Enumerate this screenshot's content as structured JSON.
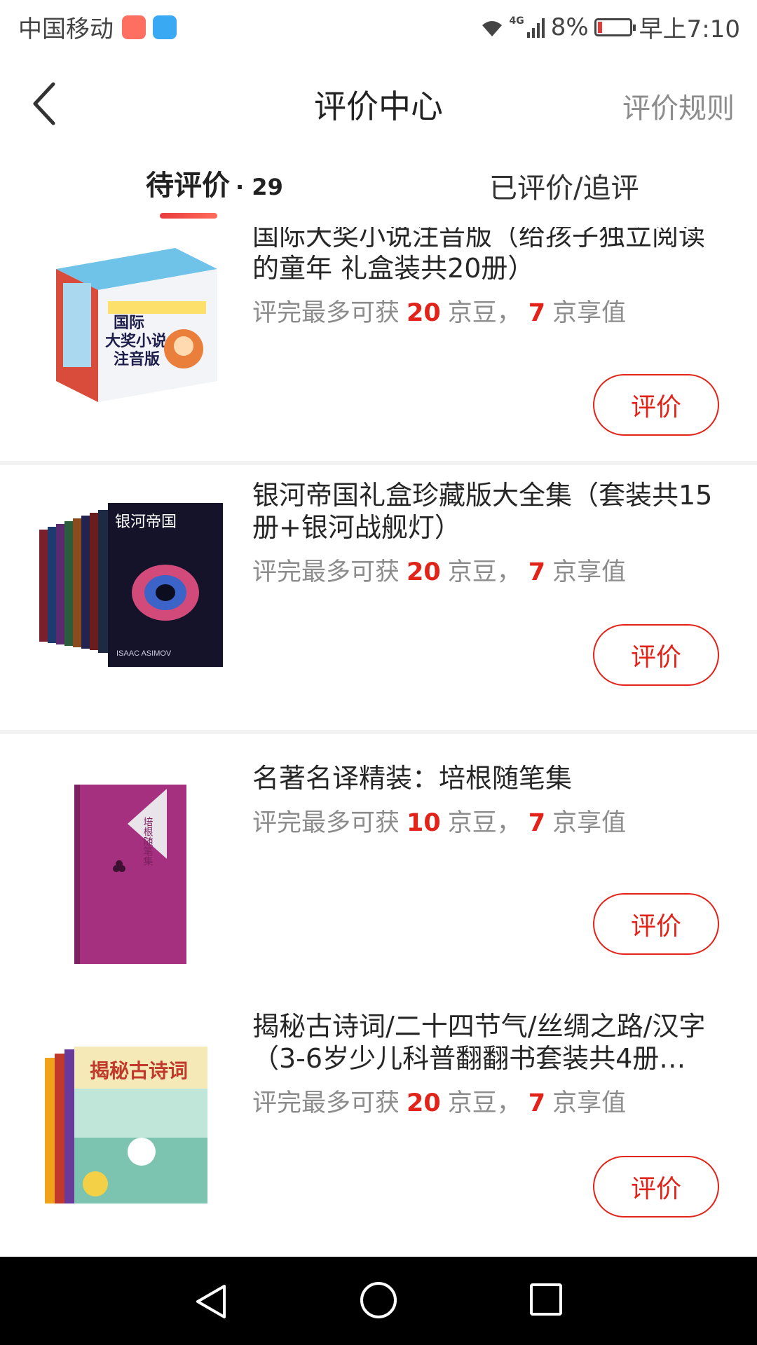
{
  "status_bar": {
    "carrier": "中国移动",
    "network": "4G",
    "battery": "8%",
    "time": "早上7:10"
  },
  "header": {
    "title": "评价中心",
    "rules_link": "评价规则"
  },
  "tabs": {
    "pending_label": "待评价",
    "pending_count": "· 29",
    "reviewed_label": "已评价/追评"
  },
  "reward_text": {
    "prefix": "评完最多可获",
    "beans_unit": "京豆，",
    "value_unit": "京享值"
  },
  "products": [
    {
      "name": "国际大奖小说注音版（给孩子独立阅读的童年 礼盒装共20册）",
      "beans": "20",
      "value": "7",
      "button": "评价"
    },
    {
      "name": "银河帝国礼盒珍藏版大全集（套装共15册+银河战舰灯）",
      "beans": "20",
      "value": "7",
      "button": "评价"
    },
    {
      "name": "名著名译精装：培根随笔集",
      "beans": "10",
      "value": "7",
      "button": "评价"
    },
    {
      "name": "揭秘古诗词/二十四节气/丝绸之路/汉字（3-6岁少儿科普翻翻书套装共4册…",
      "beans": "20",
      "value": "7",
      "button": "评价"
    }
  ],
  "thumb_text": {
    "p1_cover": "国际 大奖小说 注音版",
    "p2_cover": "银河帝国",
    "p2_author": "ISAAC ASIMOV",
    "p3_cover": "培根随笔集",
    "p4_cover": "揭秘古诗词"
  },
  "colors": {
    "accent": "#e2231a",
    "background": "#f2f2f2"
  },
  "icons": {
    "back": "chevron-left-icon",
    "nav_back": "triangle-back-icon",
    "nav_home": "circle-home-icon",
    "nav_recent": "square-recent-icon"
  }
}
